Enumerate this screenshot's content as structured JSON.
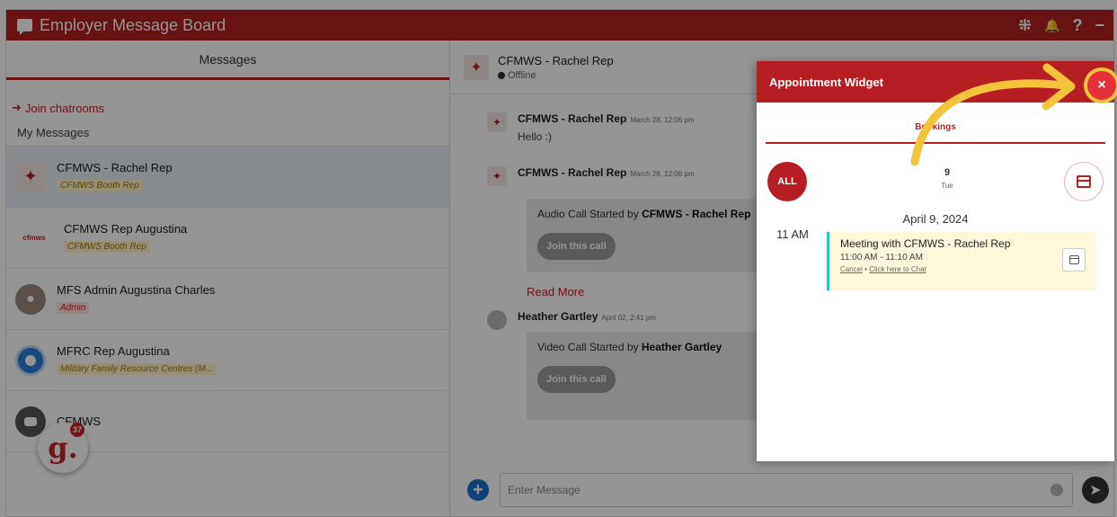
{
  "header": {
    "title": "Employer Message Board",
    "icons": [
      "collapse-icon",
      "bell-icon",
      "help-icon",
      "minimize-icon"
    ],
    "icon_glyphs": [
      "⁜",
      "🔔",
      "?",
      "−"
    ]
  },
  "left": {
    "tab_label": "Messages",
    "join_label": "Join chatrooms",
    "section_label": "My Messages",
    "contacts": [
      {
        "name": "CFMWS - Rachel Rep",
        "tag": "CFMWS Booth Rep"
      },
      {
        "name": "CFMWS Rep Augustina",
        "tag": "CFMWS Booth Rep"
      },
      {
        "name": "MFS Admin Augustina Charles",
        "tag": "Admin"
      },
      {
        "name": "MFRC Rep Augustina",
        "tag": "Military Family Resource Centres (M..."
      },
      {
        "name": "CFMWS",
        "tag": ""
      }
    ],
    "badge_letter": "g.",
    "badge_count": "37"
  },
  "chat": {
    "contact_name": "CFMWS - Rachel Rep",
    "status": "Offline",
    "messages": [
      {
        "sender": "CFMWS - Rachel Rep",
        "time": "March 28, 12:06 pm",
        "text": "Hello :)"
      },
      {
        "sender": "CFMWS - Rachel Rep",
        "time": "March 28, 12:06 pm",
        "call_prefix": "Audio Call Started by ",
        "call_by": "CFMWS - Rachel Rep",
        "button": "Join this call"
      },
      {
        "sender": "Heather Gartley",
        "time": "April 02, 2:41 pm",
        "call_prefix": "Video Call Started by ",
        "call_by": "Heather Gartley",
        "button": "Join this call"
      }
    ],
    "read_more": "Read More",
    "composer_placeholder": "Enter Message"
  },
  "widget": {
    "title": "Appointment Widget",
    "tab_label": "Bookings",
    "all_label": "ALL",
    "day_number": "9",
    "day_name": "Tue",
    "date_label": "April 9, 2024",
    "slot_label": "11 AM",
    "meeting": {
      "title": "Meeting with CFMWS - Rachel Rep",
      "time": "11:00 AM - 11:10 AM",
      "cancel": "Cancel",
      "separator": "•",
      "chat_link": "Click here to Chat"
    },
    "close_glyph": "×"
  },
  "colors": {
    "brand": "#b51f24",
    "close": "#e5303a",
    "highlight": "#f5c33b",
    "accent_bar": "#2ec4c4"
  }
}
